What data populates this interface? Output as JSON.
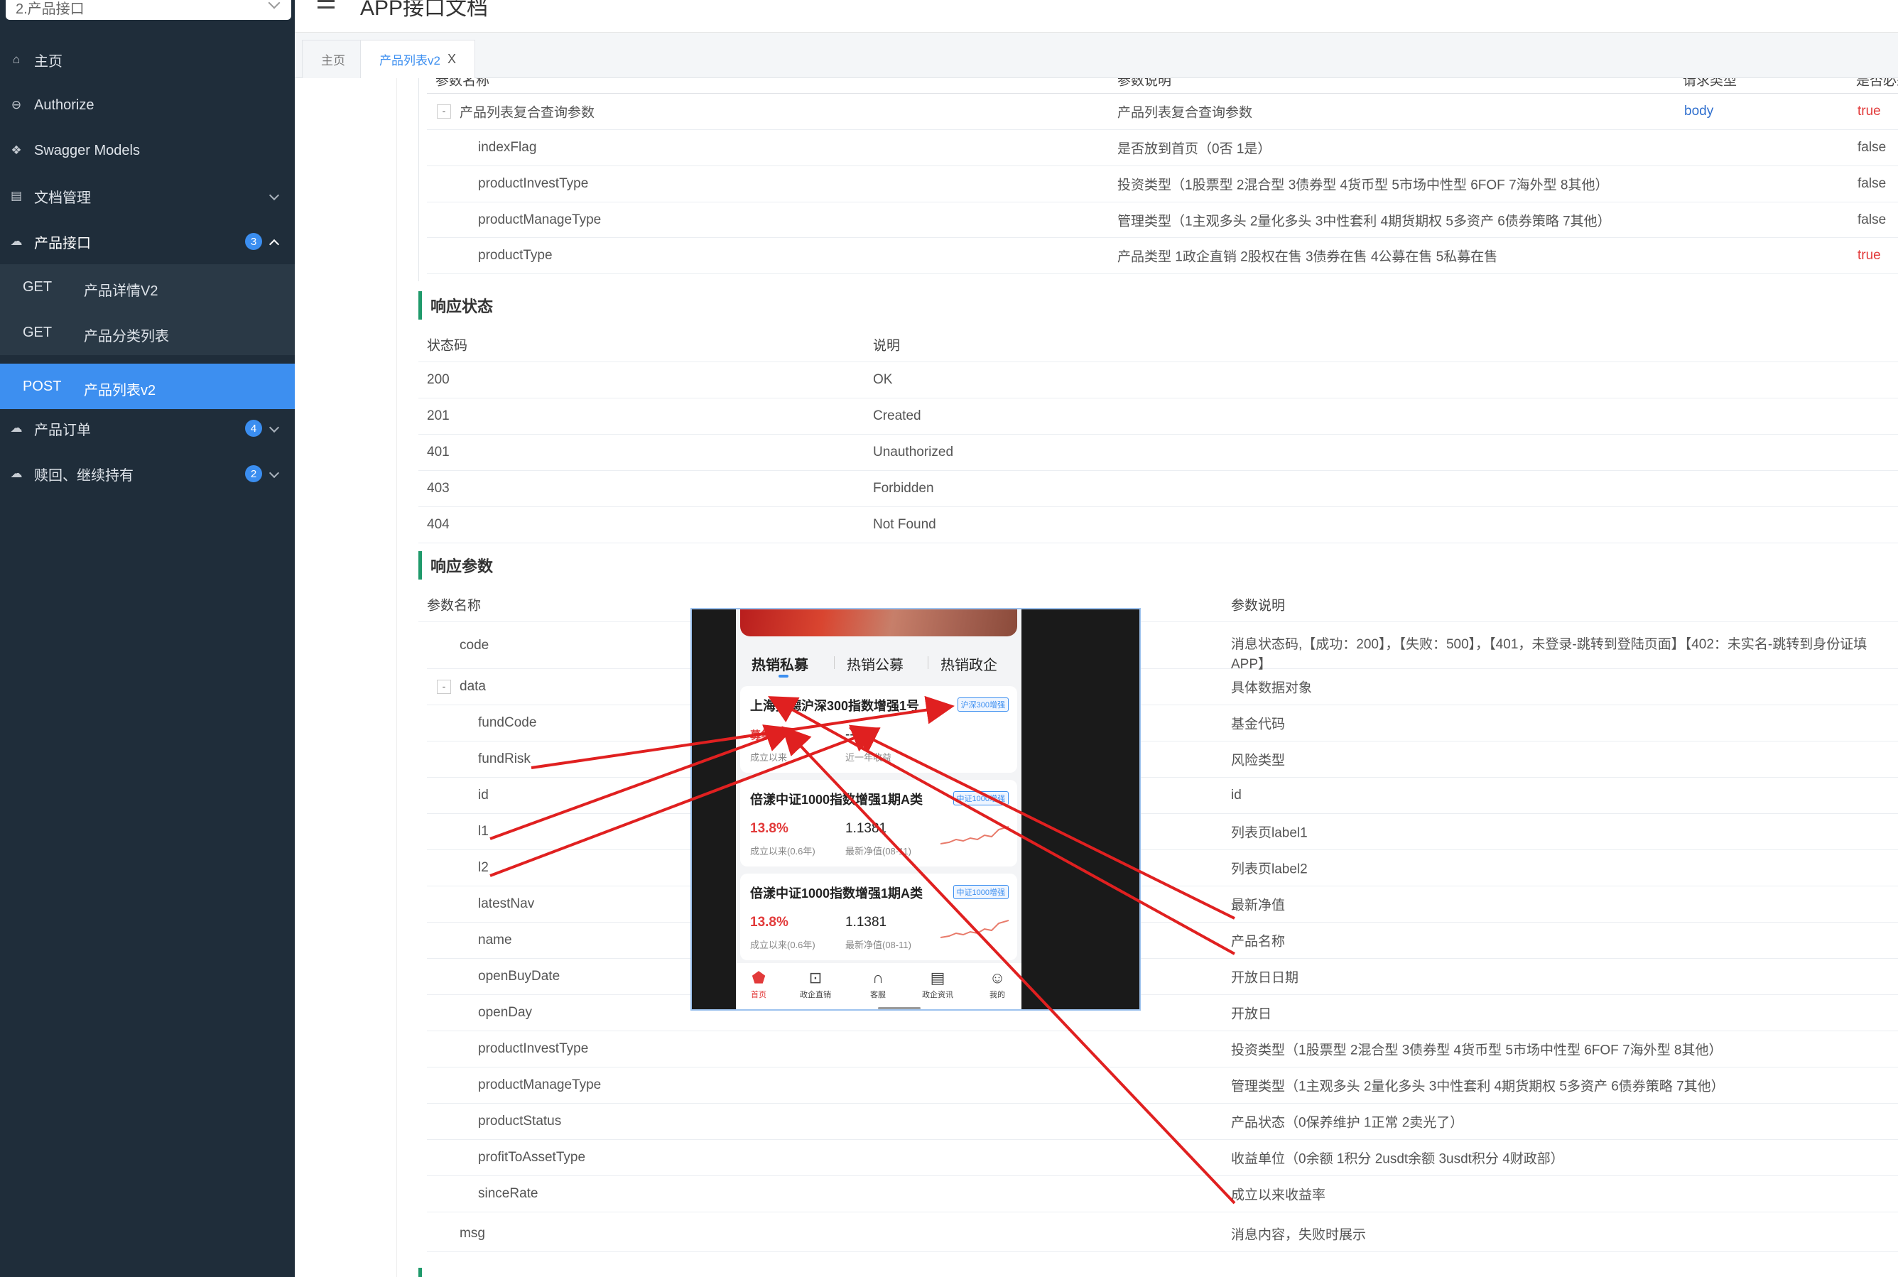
{
  "sidebar": {
    "group_select": "2.产品接口",
    "nav": [
      {
        "label": "主页",
        "icon": "home-icon"
      },
      {
        "label": "Authorize",
        "icon": "lock-icon"
      },
      {
        "label": "Swagger Models",
        "icon": "cube-icon"
      },
      {
        "label": "文档管理",
        "icon": "document-icon"
      },
      {
        "label": "产品接口",
        "icon": "cloud-icon",
        "badge": "3"
      },
      {
        "label": "产品订单",
        "icon": "cloud-icon",
        "badge": "4"
      },
      {
        "label": "赎回、继续持有",
        "icon": "cloud-icon",
        "badge": "2"
      }
    ],
    "sub": [
      {
        "method": "GET",
        "title": "产品详情V2"
      },
      {
        "method": "GET",
        "title": "产品分类列表"
      },
      {
        "method": "POST",
        "title": "产品列表v2"
      }
    ]
  },
  "header": {
    "title": "APP接口文档"
  },
  "tabs": [
    {
      "label": "主页"
    },
    {
      "label": "产品列表v2",
      "close": "X"
    }
  ],
  "request_params": {
    "header": [
      "参数名称",
      "参数说明",
      "请求类型",
      "是否必须"
    ],
    "rows": [
      {
        "toggle": "-",
        "name": "产品列表复合查询参数",
        "desc": "产品列表复合查询参数",
        "type": "body",
        "required": "true"
      },
      {
        "name": "indexFlag",
        "desc": "是否放到首页（0否 1是）",
        "required": "false"
      },
      {
        "name": "productInvestType",
        "desc": "投资类型（1股票型 2混合型 3债券型 4货币型 5市场中性型 6FOF 7海外型 8其他）",
        "required": "false"
      },
      {
        "name": "productManageType",
        "desc": "管理类型（1主观多头 2量化多头 3中性套利 4期货期权 5多资产 6债券策略 7其他）",
        "required": "false"
      },
      {
        "name": "productType",
        "desc": "产品类型 1政企直销 2股权在售 3债券在售 4公募在售 5私募在售",
        "required": "true"
      }
    ]
  },
  "response_status": {
    "title": "响应状态",
    "header": [
      "状态码",
      "说明"
    ],
    "rows": [
      {
        "code": "200",
        "desc": "OK"
      },
      {
        "code": "201",
        "desc": "Created"
      },
      {
        "code": "401",
        "desc": "Unauthorized"
      },
      {
        "code": "403",
        "desc": "Forbidden"
      },
      {
        "code": "404",
        "desc": "Not Found"
      }
    ]
  },
  "response_params": {
    "title": "响应参数",
    "header": [
      "参数名称",
      "参数说明"
    ],
    "code_row": {
      "name": "code",
      "desc1": "消息状态码,【成功：200】，【失败：500】，【401，未登录-跳转到登陆页面】【402：未实名-跳转到身份证填",
      "desc2": "APP】"
    },
    "data_row": {
      "toggle": "-",
      "name": "data",
      "desc": "具体数据对象"
    },
    "rows": [
      {
        "name": "fundCode",
        "desc": "基金代码"
      },
      {
        "name": "fundRisk",
        "desc": "风险类型"
      },
      {
        "name": "id",
        "desc": "id"
      },
      {
        "name": "l1",
        "desc": "列表页label1"
      },
      {
        "name": "l2",
        "desc": "列表页label2"
      },
      {
        "name": "latestNav",
        "desc": "最新净值"
      },
      {
        "name": "name",
        "desc": "产品名称"
      },
      {
        "name": "openBuyDate",
        "desc": "开放日日期"
      },
      {
        "name": "openDay",
        "desc": "开放日"
      },
      {
        "name": "productInvestType",
        "desc": "投资类型（1股票型 2混合型 3债券型 4货币型 5市场中性型 6FOF 7海外型 8其他）"
      },
      {
        "name": "productManageType",
        "desc": "管理类型（1主观多头 2量化多头 3中性套利 4期货期权 5多资产 6债券策略 7其他）"
      },
      {
        "name": "productStatus",
        "desc": "产品状态（0保养维护 1正常 2卖光了）"
      },
      {
        "name": "profitToAssetType",
        "desc": "收益单位（0余额 1积分 2usdt余额 3usdt积分 4财政部）"
      },
      {
        "name": "sinceRate",
        "desc": "成立以来收益率"
      }
    ],
    "msg_row": {
      "name": "msg",
      "desc": "消息内容，失败时展示"
    }
  },
  "phone": {
    "tabs": [
      "热销私募",
      "热销公募",
      "热销政企"
    ],
    "cards": [
      {
        "name": "上海宽德沪深300指数增强1号",
        "tag": "沪深300增强",
        "v1": "募集中",
        "v2": "--",
        "l1": "成立以来",
        "l2": "近一年收益"
      },
      {
        "name": "倍漾中证1000指数增强1期A类",
        "tag": "中证1000增强",
        "v1": "13.8%",
        "v2": "1.1381",
        "l1": "成立以来(0.6年)",
        "l2": "最新净值(08-11)"
      },
      {
        "name": "倍漾中证1000指数增强1期A类",
        "tag": "中证1000增强",
        "v1": "13.8%",
        "v2": "1.1381",
        "l1": "成立以来(0.6年)",
        "l2": "最新净值(08-11)"
      }
    ],
    "bottom_nav": [
      {
        "label": "首页",
        "icon": "home-icon"
      },
      {
        "label": "政企直销",
        "icon": "chart-icon"
      },
      {
        "label": "客服",
        "icon": "headset-icon"
      },
      {
        "label": "政企资讯",
        "icon": "news-icon"
      },
      {
        "label": "我的",
        "icon": "user-icon"
      }
    ]
  },
  "colors": {
    "sidebar_bg": "#1f2d3a",
    "active_blue": "#3d8ff0",
    "required_red": "#e23a3a",
    "annotation_red": "#e02020",
    "section_green": "#1f9a6b"
  }
}
